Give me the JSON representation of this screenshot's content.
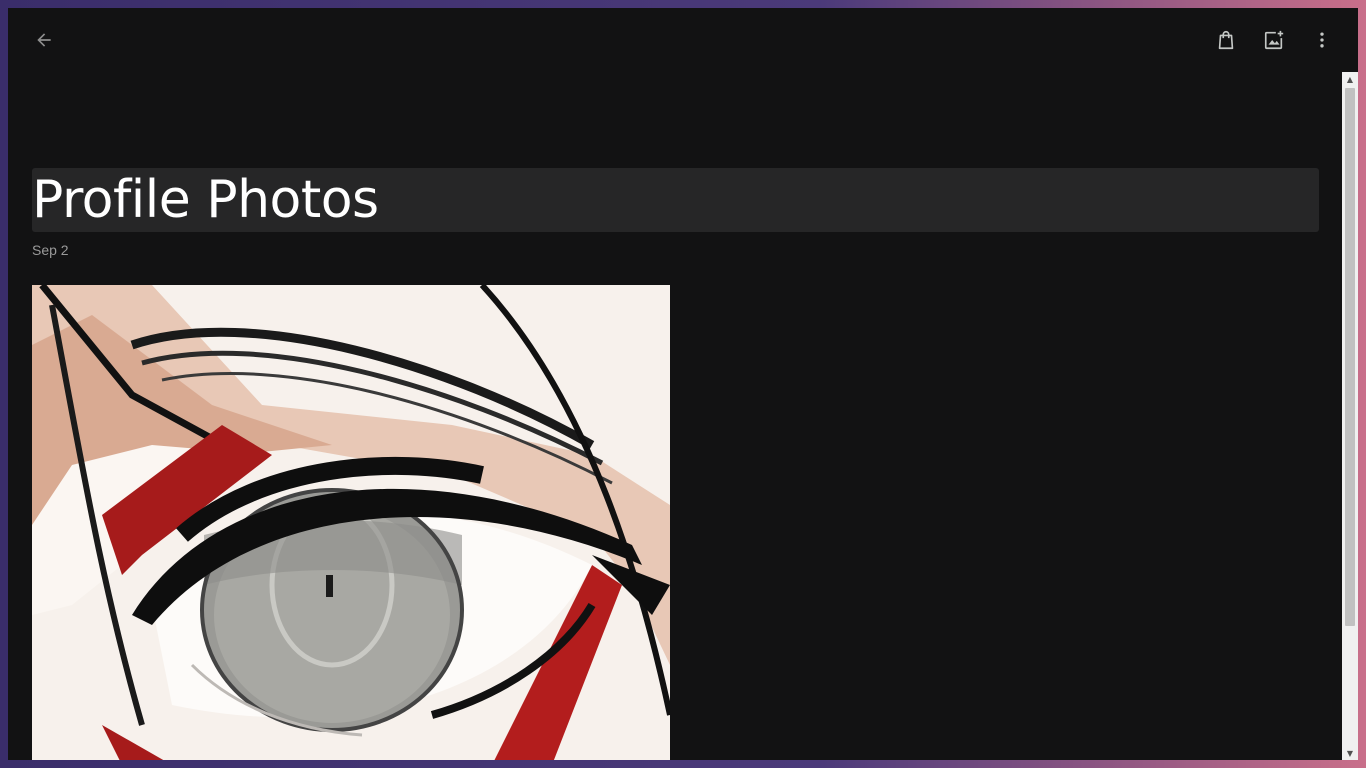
{
  "album": {
    "title": "Profile Photos",
    "date": "Sep 2"
  },
  "toolbar": {
    "back_icon": "arrow-back-icon",
    "shopping_icon": "shopping-bag-icon",
    "add_photo_icon": "add-photo-icon",
    "more_icon": "more-vert-icon"
  },
  "colors": {
    "background": "#121213",
    "title_box": "#262627",
    "title_text": "#ffffff",
    "date_text": "#9a9a9a",
    "icon": "#c4c7c5"
  }
}
